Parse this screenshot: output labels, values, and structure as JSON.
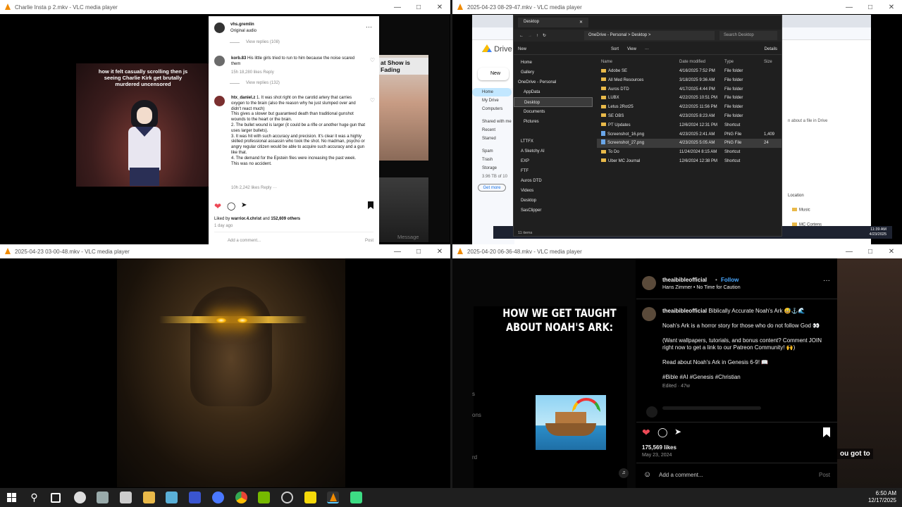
{
  "windows": [
    {
      "title": "Charlie Insta p 2.mkv - VLC media player"
    },
    {
      "title": "2025-04-23 08-29-47.mkv - VLC media player"
    },
    {
      "title": "2025-04-23 03-00-48.mkv - VLC media player"
    },
    {
      "title": "2025-04-20 06-36-48.mkv - VLC media player"
    }
  ],
  "w1": {
    "caption": "how it felt casually scrolling then js seeing Charlie Kirk get brutally murdered uncensored",
    "header_user": "vhs.gremlin",
    "header_audio": "Original audio",
    "view_replies_1": "View replies (108)",
    "c1_user": "korb.83",
    "c1_text": "His little girls tried to run to him because the noise scared them",
    "c1_meta": "15h  18,280 likes  Reply",
    "view_replies_2": "View replies (132)",
    "c2_user": "htx_daniel.z",
    "c2_lines": [
      "1. It was shot right on the carotid artery that carries oxygen to the brain (also the reason why he just slumped over and didn't react much)",
      "This gives a slower but guaranteed death than traditional gunshot wounds to the heart or the brain.",
      "2. The bullet wound is larger (it could be a rifle or another huge gun that uses larger bullets).",
      "3. It was hit with such accuracy and precision. It's clear it was a highly skilled professional assassin who took the shot. No madman, psycho or angry regular citizen would be able to acquire such accuracy and a gun like that.",
      "4. The demand for the Epstein files were increasing the past week.",
      "This was no accident."
    ],
    "c2_meta": "10h  2,242 likes  Reply  ···",
    "liked_by": "Liked by",
    "liked_user": "warrior.4.christ",
    "liked_and": "and",
    "liked_others": "152,609 others",
    "time_ago": "1 day ago",
    "add_comment": "Add a comment...",
    "post": "Post",
    "right_thumb_text": "at Show is Fading",
    "message": "Message"
  },
  "w2": {
    "drive_brand": "Drive",
    "new_btn": "New",
    "drive_nav": [
      "Home",
      "My Drive",
      "Computers",
      "Shared with me",
      "Recent",
      "Starred",
      "Spam",
      "Trash",
      "Storage"
    ],
    "drive_storage": "3.96 TB of 10",
    "get_more": "Get more",
    "explorer_tab": "Desktop",
    "bc_items": [
      "OneDrive - Personal",
      ">",
      "Desktop",
      ">"
    ],
    "search": "Search Desktop",
    "cmd": [
      "New",
      "Sort",
      "View",
      "···",
      "Details"
    ],
    "tree": [
      "Home",
      "Gallery",
      "OneDrive - Personal",
      "AppData",
      "Desktop",
      "Documents",
      "Pictures",
      "",
      "LTTFX",
      "A Sketchy AI",
      "EXP",
      "FTF",
      "Auros DTD",
      "Videos",
      "Desktop",
      "SasClipper"
    ],
    "headers": [
      "Name",
      "Date modified",
      "Type",
      "Size"
    ],
    "files": [
      {
        "name": "Adobe SE",
        "date": "4/16/2025 7:52 PM",
        "type": "File folder",
        "size": "",
        "kind": "folder"
      },
      {
        "name": "All Med Resources",
        "date": "3/18/2025 9:36 AM",
        "type": "File folder",
        "size": "",
        "kind": "folder"
      },
      {
        "name": "Auros DTD",
        "date": "4/17/2025 4:44 PM",
        "type": "File folder",
        "size": "",
        "kind": "folder"
      },
      {
        "name": "LUBX",
        "date": "4/22/2025 10:51 PM",
        "type": "File folder",
        "size": "",
        "kind": "folder"
      },
      {
        "name": "Letus 2Rot25",
        "date": "4/22/2025 11:56 PM",
        "type": "File folder",
        "size": "",
        "kind": "folder"
      },
      {
        "name": "SE OBS",
        "date": "4/23/2025 8:23 AM",
        "type": "File folder",
        "size": "",
        "kind": "folder"
      },
      {
        "name": "PT Updates",
        "date": "12/6/2024 12:31 PM",
        "type": "Shortcut",
        "size": "",
        "kind": "folder"
      },
      {
        "name": "Screenshot_16.png",
        "date": "4/23/2025 2:41 AM",
        "type": "PNG File",
        "size": "1,409",
        "kind": "png"
      },
      {
        "name": "Screenshot_27.png",
        "date": "4/23/2025 5:05 AM",
        "type": "PNG File",
        "size": "24",
        "kind": "png"
      },
      {
        "name": "To Do",
        "date": "11/24/2024 8:15 AM",
        "type": "Shortcut",
        "size": "",
        "kind": "folder"
      },
      {
        "name": "Uber MC Journal",
        "date": "12/6/2024 12:38 PM",
        "type": "Shortcut",
        "size": "",
        "kind": "folder"
      }
    ],
    "status": "11 items",
    "right_hint": "n about a file in Drive",
    "location": "Location",
    "loc_items": [
      "Music",
      "MC Cortens"
    ],
    "clock_time": "11:39 AM",
    "clock_date": "4/23/2025"
  },
  "w4": {
    "meme_line1": "HOW WE GET TAUGHT",
    "meme_line2": "ABOUT NOAH'S ARK:",
    "user": "theaibibleofficial",
    "follow": "Follow",
    "audio": "Hans Zimmer • No Time for Caution",
    "caption_user": "theaibibleofficial",
    "caption_title": "Biblically Accurate Noah's Ark 😅⚓🌊",
    "p1": "Noah's Ark is a horror story for those who do not follow God 👀",
    "p2": "(Want wallpapers, tutorials, and bonus content? Comment JOIN right now to get a link to our Patreon Community! 🙌)",
    "p3": "Read about Noah's Ark in Genesis 6-9! 📖",
    "tags": "#Bible #AI #Genesis #Christian",
    "edited": "Edited · 47w",
    "likes": "175,569 likes",
    "date": "May 23, 2024",
    "add_comment": "Add a comment...",
    "post": "Post",
    "left_snips": [
      "s",
      "ons",
      "rd"
    ],
    "right_snip": "ou got to"
  },
  "taskbar": {
    "time": "6:50 AM",
    "date": "12/17/2025"
  },
  "colors": {
    "vlc_orange": "#f08a00",
    "ig_heart": "#ed4956",
    "ig_link": "#4aa8ff"
  }
}
